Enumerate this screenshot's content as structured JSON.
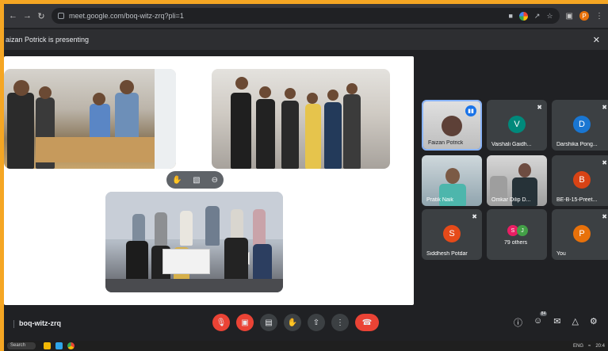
{
  "browser": {
    "url": "meet.google.com/boq-witz-zrq?pli=1",
    "profile_initial": "P"
  },
  "banner": {
    "presenting_text": "aizan Potrick is presenting"
  },
  "slide_controls": {
    "icons": [
      "pan-icon",
      "pip-icon",
      "more-icon"
    ]
  },
  "participants": [
    {
      "name": "Faizan Potrick",
      "initial": "",
      "color": "",
      "state": "speaking",
      "type": "video"
    },
    {
      "name": "Vaishali Gaidh...",
      "initial": "V",
      "color": "#00897b",
      "state": "muted",
      "type": "avatar"
    },
    {
      "name": "Darshika Pong...",
      "initial": "D",
      "color": "#1976d2",
      "state": "muted",
      "type": "avatar"
    },
    {
      "name": "Pratik Naik",
      "initial": "",
      "color": "",
      "state": "",
      "type": "video"
    },
    {
      "name": "Omkar Dilip D...",
      "initial": "",
      "color": "",
      "state": "",
      "type": "video"
    },
    {
      "name": "BE-B-15-Preet...",
      "initial": "B",
      "color": "#d84315",
      "state": "muted",
      "type": "avatar"
    },
    {
      "name": "Siddhesh Potdar",
      "initial": "S",
      "color": "#e64a19",
      "state": "muted",
      "type": "avatar"
    },
    {
      "name": "79 others",
      "initial": "",
      "color": "",
      "state": "",
      "type": "group",
      "avatars": [
        {
          "initial": "S",
          "color": "#e91e63"
        },
        {
          "initial": "J",
          "color": "#43a047"
        }
      ]
    },
    {
      "name": "You",
      "initial": "P",
      "color": "#e8710a",
      "state": "muted",
      "type": "avatar"
    }
  ],
  "bottom": {
    "meeting_code": "boq-witz-zrq",
    "people_badge": "84"
  },
  "taskbar": {
    "search_label": "Search",
    "lang": "ENG",
    "time": "20:4"
  },
  "colors": {
    "border": "#f5a623",
    "end_call": "#ea4335",
    "active_speaker_border": "#8ab4f8"
  }
}
